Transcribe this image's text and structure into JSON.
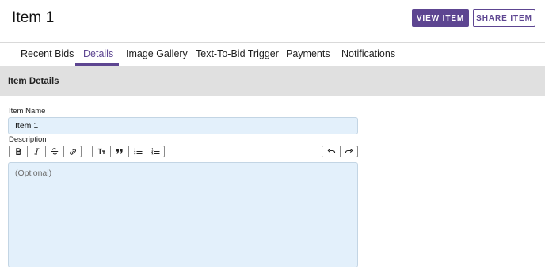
{
  "header": {
    "title": "Item 1",
    "view_button": "VIEW ITEM",
    "share_button": "SHARE ITEM"
  },
  "tabs": [
    {
      "label": "Recent Bids",
      "active": false
    },
    {
      "label": "Details",
      "active": true
    },
    {
      "label": "Image Gallery",
      "active": false
    },
    {
      "label": "Text-To-Bid Trigger",
      "active": false
    },
    {
      "label": "Payments",
      "active": false
    },
    {
      "label": "Notifications",
      "active": false
    }
  ],
  "section": {
    "title": "Item Details"
  },
  "form": {
    "name_label": "Item Name",
    "name_value": "Item 1",
    "description_label": "Description",
    "description_placeholder": "(Optional)"
  },
  "toolbar": {
    "formatting": [
      "bold-icon",
      "italic-icon",
      "strikethrough-icon",
      "link-icon"
    ],
    "blocks": [
      "heading-icon",
      "quote-icon",
      "bulleted-list-icon",
      "numbered-list-icon"
    ],
    "history": [
      "undo-icon",
      "redo-icon"
    ]
  },
  "colors": {
    "accent": "#5d4591",
    "section_band": "#e0e0e0",
    "input_background": "#e3f0fb"
  }
}
